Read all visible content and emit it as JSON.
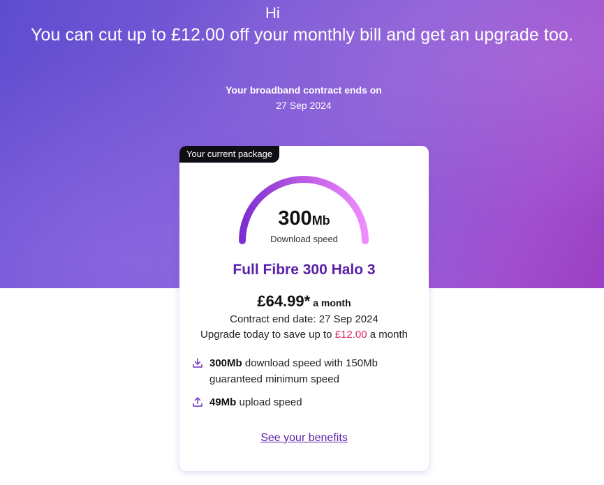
{
  "hero": {
    "greeting": "Hi",
    "headline": "You can cut up to £12.00 off your monthly bill and get an upgrade too.",
    "contract_label": "Your broadband contract ends on",
    "contract_date": "27 Sep 2024"
  },
  "package": {
    "badge": "Your current package",
    "speed_value": "300",
    "speed_unit": "Mb",
    "speed_label": "Download speed",
    "plan_name": "Full Fibre 300 Halo 3",
    "price": "£64.99*",
    "price_period": "a month",
    "contract_end": "Contract end date: 27 Sep 2024",
    "save_prefix": "Upgrade today to save up to",
    "save_amount": "£12.00",
    "save_suffix": "a month",
    "features": [
      {
        "icon": "download-icon",
        "bold": "300Mb",
        "text": " download speed with 150Mb guaranteed minimum speed"
      },
      {
        "icon": "upload-icon",
        "bold": "49Mb",
        "text": " upload speed"
      }
    ],
    "benefits_link": "See your benefits"
  },
  "colors": {
    "accent": "#5a1fa8",
    "highlight": "#e0245e",
    "gauge_start": "#7b2fd0",
    "gauge_end": "#f08cff"
  }
}
